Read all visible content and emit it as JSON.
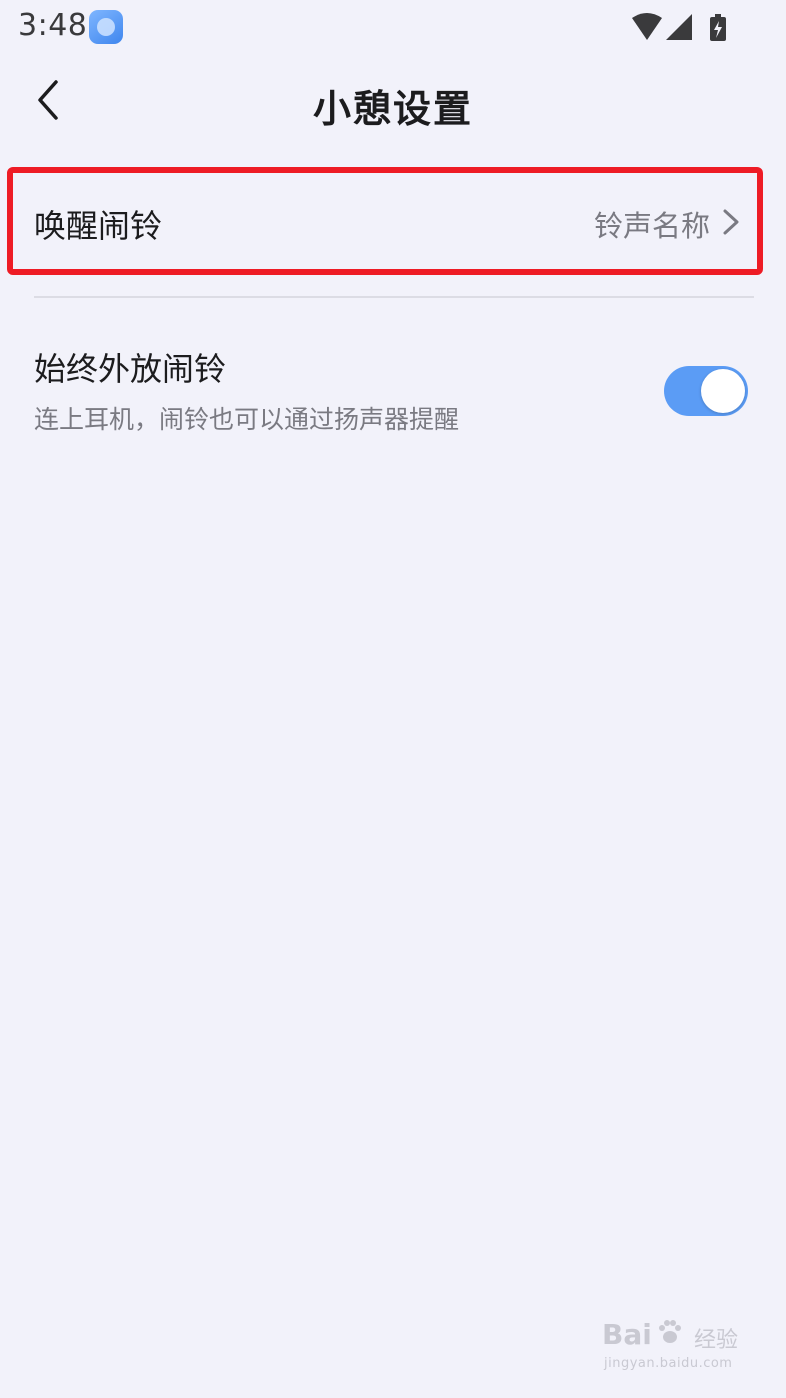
{
  "status_bar": {
    "time": "3:48",
    "icons": [
      "app-notification-icon",
      "wifi-icon",
      "signal-icon",
      "battery-charging-icon"
    ]
  },
  "header": {
    "title": "小憩设置",
    "back_icon": "chevron-left-icon"
  },
  "settings": {
    "alarm": {
      "label": "唤醒闹铃",
      "value": "铃声名称",
      "icon": "chevron-right-icon"
    },
    "speaker": {
      "title": "始终外放闹铃",
      "subtitle": "连上耳机，闹铃也可以通过扬声器提醒",
      "enabled": true
    }
  },
  "watermark": {
    "brand": "Bai",
    "brand_suffix": "经验",
    "url": "jingyan.baidu.com"
  },
  "colors": {
    "background": "#f2f2fa",
    "highlight": "#ee1c25",
    "toggle_on": "#5b9cf5",
    "secondary_text": "#7a7a82"
  }
}
